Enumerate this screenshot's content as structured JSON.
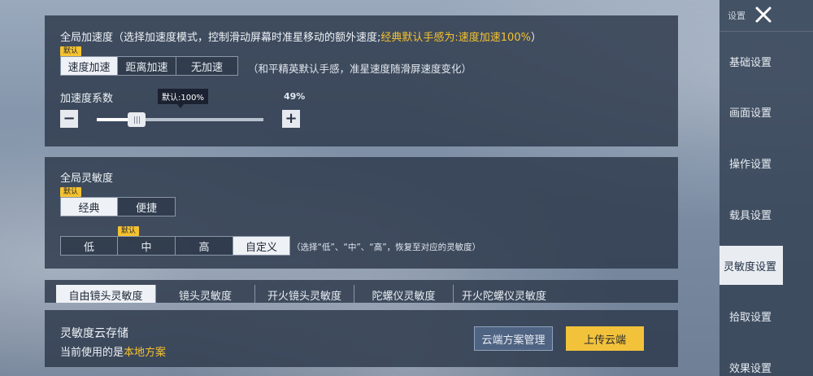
{
  "global_accel": {
    "title": "全局加速度（选择加速度模式，控制滑动屏幕时准星移动的额外速度;",
    "title_hl": "经典默认手感为:速度加速100%",
    "title_end": "）",
    "default_tag": "默认",
    "modes": [
      "速度加速",
      "距离加速",
      "无加速"
    ],
    "note": "（和平精英默认手感，准星速度随滑屏速度变化）"
  },
  "accel_coef": {
    "label": "加速度系数",
    "tooltip": "默认:100%",
    "value_text": "49%",
    "progress": 0.24,
    "minus": "−",
    "plus": "+"
  },
  "global_sens": {
    "title": "全局灵敏度",
    "default_tag": "默认",
    "modes": [
      "经典",
      "便捷"
    ],
    "level_tag": "默认",
    "levels": [
      "低",
      "中",
      "高",
      "自定义"
    ],
    "note": "（选择“低”、“中”、“高”，恢复至对应的灵敏度）"
  },
  "sens_tabs": [
    "自由镜头灵敏度",
    "镜头灵敏度",
    "开火镜头灵敏度",
    "陀螺仪灵敏度",
    "开火陀螺仪灵敏度"
  ],
  "cloud": {
    "title": "灵敏度云存储",
    "current_prefix": "当前使用的是",
    "current_value": "本地方案",
    "manage_label": "云端方案管理",
    "upload_label": "上传云端"
  },
  "sidebar": {
    "header": "设置",
    "items": [
      "基础设置",
      "画面设置",
      "操作设置",
      "载具设置",
      "灵敏度设置",
      "拾取设置",
      "效果设置"
    ],
    "active_index": 4
  },
  "colors": {
    "accent": "#f5c230",
    "active_bg": "#eef1f5"
  }
}
